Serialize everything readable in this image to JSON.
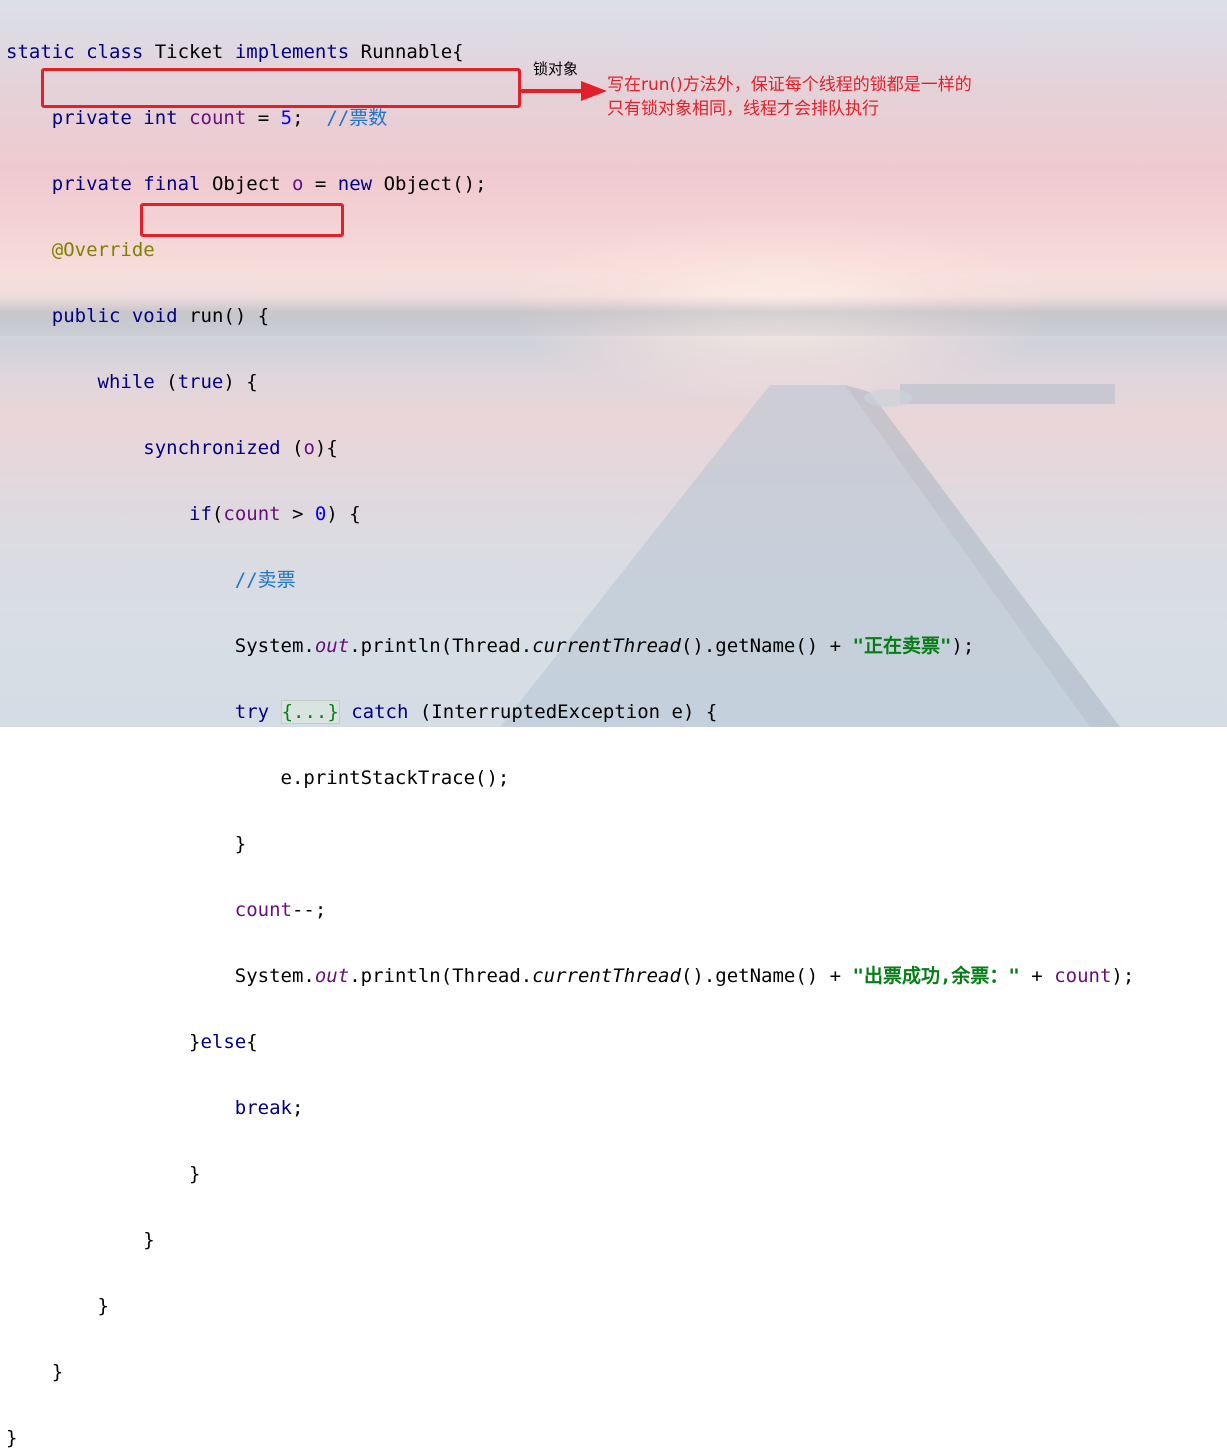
{
  "colors": {
    "keyword": "#000080",
    "field": "#660e7a",
    "number": "#0000ff",
    "comment": "#1e74c7",
    "annotation": "#808000",
    "string": "#067d17",
    "highlight_box": "#e1202a"
  },
  "code": {
    "l1": {
      "static": "static",
      "class": "class",
      "name": " Ticket ",
      "implements": "implements",
      "iface": " Runnable{"
    },
    "l2": {
      "private": "private",
      "int": "int",
      "count": "count",
      "eq": " = ",
      "five": "5",
      "semi": ";  ",
      "comment": "//票数"
    },
    "l3": {
      "private": "private",
      "final": "final",
      "type": " Object ",
      "o": "o",
      "eq": " = ",
      "new": "new",
      "rest": " Object();"
    },
    "l4": {
      "annotation": "@Override"
    },
    "l5": {
      "public": "public",
      "void": "void",
      "rest": " run() {"
    },
    "l6": {
      "while": "while",
      "open": " (",
      "true": "true",
      "close": ") {"
    },
    "l7": {
      "synchronized": "synchronized",
      "open": " (",
      "o": "o",
      "close": "){"
    },
    "l8": {
      "if": "if",
      "open": "(",
      "count": "count",
      "gt": " > ",
      "zero": "0",
      "close": ") {"
    },
    "l9": {
      "comment": "//卖票"
    },
    "l10": {
      "system": "System.",
      "out": "out",
      "println": ".println(Thread.",
      "current": "currentThread",
      "getname": "().getName() + ",
      "str": "\"正在卖票\"",
      "end": ");"
    },
    "l11": {
      "try": "try",
      "fold": "{...}",
      "catch": "catch",
      "rest": " (InterruptedException e) {"
    },
    "l12": {
      "text": "e.printStackTrace();"
    },
    "l13": {
      "text": "}"
    },
    "l14": {
      "count": "count",
      "rest": "--;"
    },
    "l15": {
      "system": "System.",
      "out": "out",
      "println": ".println(Thread.",
      "current": "currentThread",
      "getname": "().getName() + ",
      "str": "\"出票成功,余票：\"",
      "plus": " + ",
      "count": "count",
      "end": ");"
    },
    "l16": {
      "open": "}",
      "else": "else",
      "close": "{"
    },
    "l17": {
      "break": "break",
      "semi": ";"
    },
    "l18": {
      "text": "}"
    },
    "l19": {
      "text": "}"
    },
    "l20": {
      "text": "}"
    },
    "l21": {
      "text": "}"
    },
    "l22": {
      "text": "}"
    }
  },
  "annotations": {
    "lock_label": "锁对象",
    "note_line1": "写在run()方法外，保证每个线程的锁都是一样的",
    "note_line2": "只有锁对象相同，线程才会排队执行"
  }
}
